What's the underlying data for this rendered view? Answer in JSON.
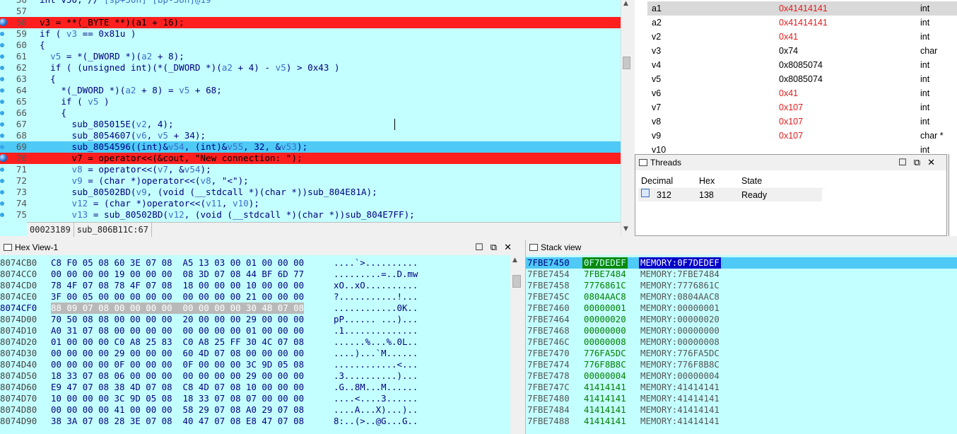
{
  "code": {
    "top_partial": "int v50; // [sp+30h] [bp-38h]@19",
    "lines": [
      {
        "num": "56",
        "parts": [
          [
            "int v50; // ",
            "kw"
          ],
          [
            "[sp+30h] [bp-38h]@19",
            "v"
          ]
        ]
      },
      {
        "num": "57",
        "parts": []
      },
      {
        "num": "58",
        "hl": "red",
        "bp": true,
        "parts": [
          [
            "v3 = **(_BYTE **)(a1 + 16);",
            "kw"
          ]
        ]
      },
      {
        "num": "59",
        "parts": [
          [
            "if ( ",
            "kw"
          ],
          [
            "v3",
            "v"
          ],
          [
            " == 0x81u )",
            "kw"
          ]
        ]
      },
      {
        "num": "60",
        "parts": [
          [
            "{",
            "kw"
          ]
        ]
      },
      {
        "num": "61",
        "parts": [
          [
            "  ",
            "kw"
          ],
          [
            "v5",
            "v"
          ],
          [
            " = *(_DWORD *)(",
            "kw"
          ],
          [
            "a2",
            "v"
          ],
          [
            " + 8);",
            "kw"
          ]
        ]
      },
      {
        "num": "62",
        "parts": [
          [
            "  if ( (unsigned int)(*(_DWORD *)(",
            "kw"
          ],
          [
            "a2",
            "v"
          ],
          [
            " + 4) - ",
            "kw"
          ],
          [
            "v5",
            "v"
          ],
          [
            ") > 0x43 )",
            "kw"
          ]
        ]
      },
      {
        "num": "63",
        "parts": [
          [
            "  {",
            "kw"
          ]
        ]
      },
      {
        "num": "64",
        "parts": [
          [
            "    *(_DWORD *)(",
            "kw"
          ],
          [
            "a2",
            "v"
          ],
          [
            " + 8) = ",
            "kw"
          ],
          [
            "v5",
            "v"
          ],
          [
            " + 68;",
            "kw"
          ]
        ]
      },
      {
        "num": "65",
        "parts": [
          [
            "    if ( ",
            "kw"
          ],
          [
            "v5",
            "v"
          ],
          [
            " )",
            "kw"
          ]
        ]
      },
      {
        "num": "66",
        "parts": [
          [
            "    {",
            "kw"
          ]
        ]
      },
      {
        "num": "67",
        "parts": [
          [
            "      sub_805015E(",
            "kw"
          ],
          [
            "v2",
            "v"
          ],
          [
            ", 4);",
            "kw"
          ]
        ]
      },
      {
        "num": "68",
        "parts": [
          [
            "      sub_8054607(",
            "kw"
          ],
          [
            "v6",
            "v"
          ],
          [
            ", ",
            "kw"
          ],
          [
            "v5",
            "v"
          ],
          [
            " + 34);",
            "kw"
          ]
        ]
      },
      {
        "num": "69",
        "hl": "blue",
        "parts": [
          [
            "      sub_8054596((int)&",
            "kw"
          ],
          [
            "v54",
            "v"
          ],
          [
            ", (int)&",
            "kw"
          ],
          [
            "v55",
            "v"
          ],
          [
            ", 32, &",
            "kw"
          ],
          [
            "v53",
            "v"
          ],
          [
            ");",
            "kw"
          ]
        ]
      },
      {
        "num": "70",
        "hl": "red",
        "bp": true,
        "parts": [
          [
            "      v7 = operator<<(&cout, \"New connection: \");",
            "kw"
          ]
        ]
      },
      {
        "num": "71",
        "parts": [
          [
            "      ",
            "kw"
          ],
          [
            "v8",
            "v"
          ],
          [
            " = operator<<(",
            "kw"
          ],
          [
            "v7",
            "v"
          ],
          [
            ", &",
            "kw"
          ],
          [
            "v54",
            "v"
          ],
          [
            ");",
            "kw"
          ]
        ]
      },
      {
        "num": "72",
        "parts": [
          [
            "      ",
            "kw"
          ],
          [
            "v9",
            "v"
          ],
          [
            " = (char *)operator<<(",
            "kw"
          ],
          [
            "v8",
            "v"
          ],
          [
            ", \"<\");",
            "kw"
          ]
        ]
      },
      {
        "num": "73",
        "parts": [
          [
            "      sub_80502BD(",
            "kw"
          ],
          [
            "v9",
            "v"
          ],
          [
            ", (void (__stdcall *)(char *))sub_804E81A);",
            "kw"
          ]
        ]
      },
      {
        "num": "74",
        "parts": [
          [
            "      ",
            "kw"
          ],
          [
            "v12",
            "v"
          ],
          [
            " = (char *)operator<<(",
            "kw"
          ],
          [
            "v11",
            "v"
          ],
          [
            ", ",
            "kw"
          ],
          [
            "v10",
            "v"
          ],
          [
            ");",
            "kw"
          ]
        ]
      },
      {
        "num": "75",
        "parts": [
          [
            "      ",
            "kw"
          ],
          [
            "v13",
            "v"
          ],
          [
            " = sub_80502BD(",
            "kw"
          ],
          [
            "v12",
            "v"
          ],
          [
            ", (void (__stdcall *)(char *))sub_804E7FF);",
            "kw"
          ]
        ]
      }
    ],
    "status_offset": "00023189",
    "status_func": "sub_806B11C:67"
  },
  "locals": {
    "rows": [
      {
        "name": "a1",
        "value": "0x41414141",
        "type": "int",
        "red": true,
        "selected": true
      },
      {
        "name": "a2",
        "value": "0x41414141",
        "type": "int",
        "red": true
      },
      {
        "name": "v2",
        "value": "0x41",
        "type": "int",
        "red": true
      },
      {
        "name": "v3",
        "value": "0x74",
        "type": "char",
        "red": false
      },
      {
        "name": "v4",
        "value": "0x8085074",
        "type": "int",
        "red": false
      },
      {
        "name": "v5",
        "value": "0x8085074",
        "type": "int",
        "red": false
      },
      {
        "name": "v6",
        "value": "0x41",
        "type": "int",
        "red": true
      },
      {
        "name": "v7",
        "value": "0x107",
        "type": "int",
        "red": true
      },
      {
        "name": "v8",
        "value": "0x107",
        "type": "int",
        "red": true
      },
      {
        "name": "v9",
        "value": "0x107",
        "type": "char *",
        "red": true
      },
      {
        "name": "v10",
        "value": "",
        "type": "int",
        "red": false
      }
    ]
  },
  "threads": {
    "title": "Threads",
    "headers": [
      "Decimal",
      "Hex",
      "State"
    ],
    "rows": [
      {
        "decimal": "312",
        "hex": "138",
        "state": "Ready"
      }
    ]
  },
  "hex": {
    "title": "Hex View-1",
    "rows": [
      {
        "addr": "8074CB0",
        "bytes": "C8 F0 05 08 60 3E 07 08  A5 13 03 00 01 00 00 00",
        "ascii": "....`>.........."
      },
      {
        "addr": "8074CC0",
        "bytes": "00 00 00 00 19 00 00 00  08 3D 07 08 44 BF 6D 77",
        "ascii": ".........=..D.mw"
      },
      {
        "addr": "8074CD0",
        "bytes": "78 4F 07 08 78 4F 07 08  18 00 00 00 10 00 00 00",
        "ascii": "xO..xO.........."
      },
      {
        "addr": "8074CE0",
        "bytes": "3F 00 05 00 00 00 00 00  00 00 00 00 21 00 00 00",
        "ascii": "?...........!..."
      },
      {
        "addr": "8074CF0",
        "bytes": "88 09 07 08 00 00 00 00  00 00 00 00 30 4B 07 08",
        "ascii": "............0K..",
        "cur": true
      },
      {
        "addr": "8074D00",
        "bytes": "70 50 08 08 00 00 00 00  20 00 00 00 29 00 00 00",
        "ascii": "pP...... ...)..."
      },
      {
        "addr": "8074D10",
        "bytes": "A0 31 07 08 00 00 00 00  00 00 00 00 01 00 00 00",
        "ascii": ".1.............."
      },
      {
        "addr": "8074D20",
        "bytes": "01 00 00 00 C0 A8 25 83  C0 A8 25 FF 30 4C 07 08",
        "ascii": "......%...%.0L.."
      },
      {
        "addr": "8074D30",
        "bytes": "00 00 00 00 29 00 00 00  60 4D 07 08 00 00 00 00",
        "ascii": "....)...`M......"
      },
      {
        "addr": "8074D40",
        "bytes": "00 00 00 00 0F 00 00 00  0F 00 00 00 3C 9D 05 08",
        "ascii": "............<..."
      },
      {
        "addr": "8074D50",
        "bytes": "18 33 07 08 06 00 00 00  00 00 00 00 29 00 00 00",
        "ascii": ".3..........)..."
      },
      {
        "addr": "8074D60",
        "bytes": "E9 47 07 08 38 4D 07 08  C8 4D 07 08 10 00 00 00",
        "ascii": ".G..8M...M......"
      },
      {
        "addr": "8074D70",
        "bytes": "10 00 00 00 3C 9D 05 08  18 33 07 08 07 00 00 00",
        "ascii": "....<....3......"
      },
      {
        "addr": "8074D80",
        "bytes": "00 00 00 00 41 00 00 00  58 29 07 08 A0 29 07 08",
        "ascii": "....A...X)...)..  "
      },
      {
        "addr": "8074D90",
        "bytes": "38 3A 07 08 28 3E 07 08  40 47 07 08 E8 47 07 08",
        "ascii": "8:..(>..@G...G.."
      }
    ]
  },
  "stack": {
    "title": "Stack view",
    "rows": [
      {
        "addr": "7FBE7450",
        "data": "0F7DEDEF",
        "mem": "MEMORY:0F7DEDEF",
        "cur": true
      },
      {
        "addr": "7FBE7454",
        "data": "7FBE7484",
        "mem": "MEMORY:7FBE7484"
      },
      {
        "addr": "7FBE7458",
        "data": "7776861C",
        "mem": "MEMORY:7776861C"
      },
      {
        "addr": "7FBE745C",
        "data": "0804AAC8",
        "mem": "MEMORY:0804AAC8"
      },
      {
        "addr": "7FBE7460",
        "data": "00000001",
        "mem": "MEMORY:00000001"
      },
      {
        "addr": "7FBE7464",
        "data": "00000020",
        "mem": "MEMORY:00000020"
      },
      {
        "addr": "7FBE7468",
        "data": "00000000",
        "mem": "MEMORY:00000000"
      },
      {
        "addr": "7FBE746C",
        "data": "00000008",
        "mem": "MEMORY:00000008"
      },
      {
        "addr": "7FBE7470",
        "data": "776FA5DC",
        "mem": "MEMORY:776FA5DC"
      },
      {
        "addr": "7FBE7474",
        "data": "776F8B8C",
        "mem": "MEMORY:776F8B8C"
      },
      {
        "addr": "7FBE7478",
        "data": "00000004",
        "mem": "MEMORY:00000004"
      },
      {
        "addr": "7FBE747C",
        "data": "41414141",
        "mem": "MEMORY:41414141"
      },
      {
        "addr": "7FBE7480",
        "data": "41414141",
        "mem": "MEMORY:41414141"
      },
      {
        "addr": "7FBE7484",
        "data": "41414141",
        "mem": "MEMORY:41414141"
      },
      {
        "addr": "7FBE7488",
        "data": "41414141",
        "mem": "MEMORY:41414141"
      }
    ]
  },
  "window_controls": {
    "minimize": "☐",
    "restore": "⧉",
    "close": "✕"
  },
  "colors": {
    "pane_bg": "#c4ffff",
    "breakpoint_line": "#ff1f1f",
    "current_line": "#4fc9f5"
  }
}
